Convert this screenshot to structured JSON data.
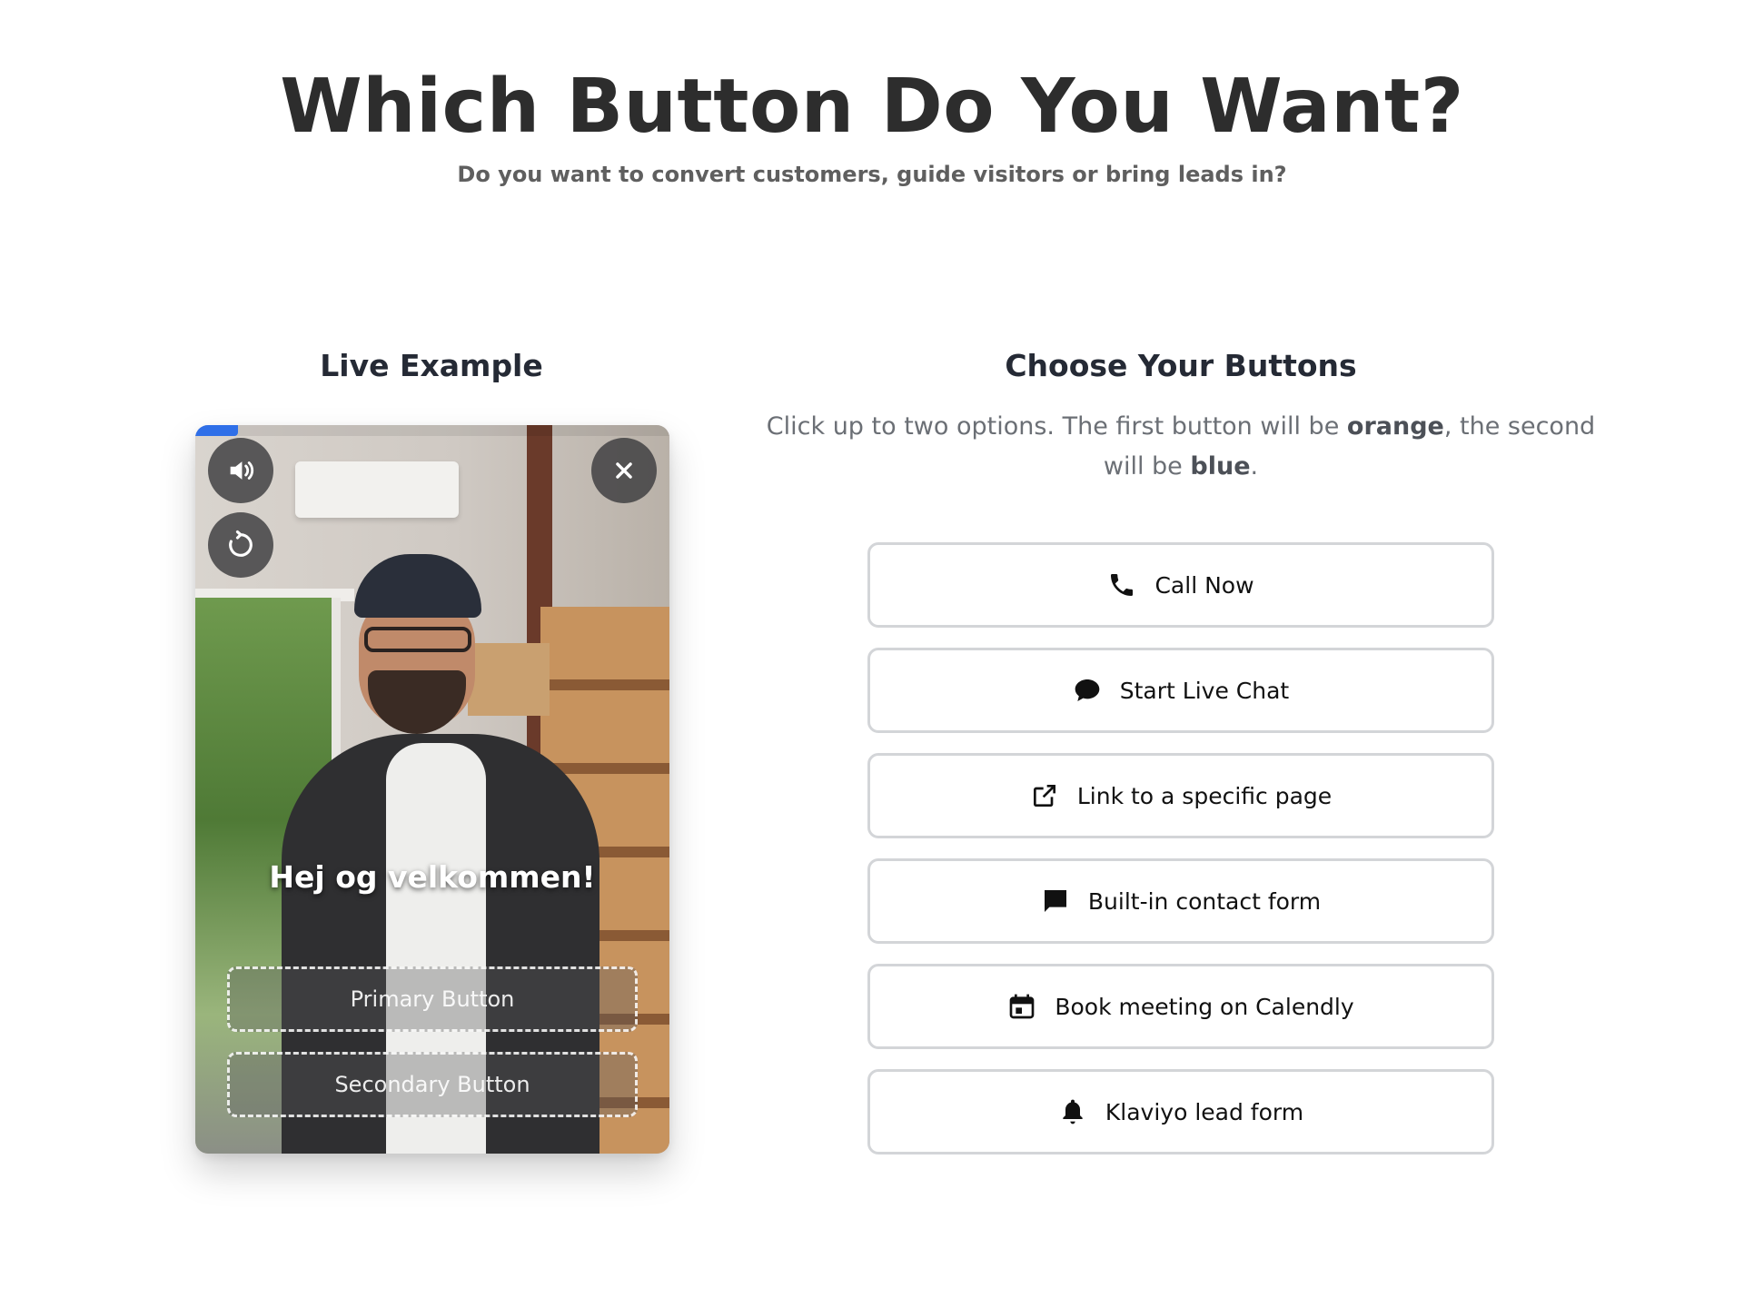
{
  "header": {
    "title": "Which Button Do You Want?",
    "subtitle": "Do you want to convert customers, guide visitors or bring leads in?"
  },
  "left_column": {
    "title": "Live Example",
    "video": {
      "caption": "Hej og velkommen!",
      "primary_button_label": "Primary Button",
      "secondary_button_label": "Secondary Button",
      "controls": [
        "volume-icon",
        "replay-icon",
        "close-icon"
      ],
      "progress_fraction": 0.09
    }
  },
  "right_column": {
    "title": "Choose Your Buttons",
    "instructions": {
      "part1": "Click up to two options. The first button will be ",
      "first_color": "orange",
      "part2": ", the second will be ",
      "second_color": "blue",
      "part3": "."
    },
    "options": [
      {
        "label": "Call Now",
        "icon": "phone-icon"
      },
      {
        "label": "Start Live Chat",
        "icon": "chat-bubble-icon"
      },
      {
        "label": "Link to a specific page",
        "icon": "external-link-icon"
      },
      {
        "label": "Built-in contact form",
        "icon": "message-icon"
      },
      {
        "label": "Book meeting on Calendly",
        "icon": "calendar-icon"
      },
      {
        "label": "Klaviyo lead form",
        "icon": "bell-icon"
      }
    ]
  },
  "colors": {
    "progress_accent": "#2f6fe8",
    "option_border": "#d3d5d8",
    "title_text": "#2d2d2d"
  }
}
